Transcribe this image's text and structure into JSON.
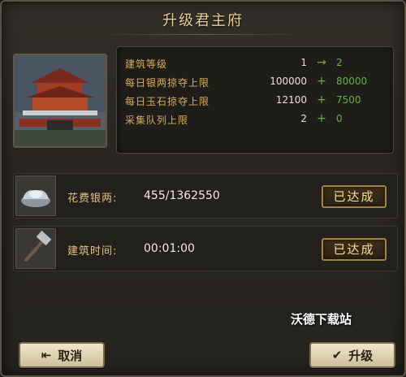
{
  "dialog": {
    "title": "升级君主府"
  },
  "stats": [
    {
      "label": "建筑等级",
      "current": "1",
      "op": "→",
      "next": "2"
    },
    {
      "label": "每日银两掠夺上限",
      "current": "100000",
      "op": "+",
      "next": "80000"
    },
    {
      "label": "每日玉石掠夺上限",
      "current": "12100",
      "op": "+",
      "next": "7500"
    },
    {
      "label": "采集队列上限",
      "current": "2",
      "op": "+",
      "next": "0"
    }
  ],
  "requirements": [
    {
      "icon": "silver-ingot-icon",
      "label": "花费银两:",
      "value": "455/1362550",
      "status": "已达成"
    },
    {
      "icon": "hammer-icon",
      "label": "建筑时间:",
      "value": "00:01:00",
      "status": "已达成"
    }
  ],
  "watermark": "沃德下载站",
  "buttons": {
    "cancel": "取消",
    "upgrade": "升级"
  },
  "colors": {
    "gold": "#d7ae59",
    "green": "#63b33b",
    "bg": "#2a2722"
  }
}
